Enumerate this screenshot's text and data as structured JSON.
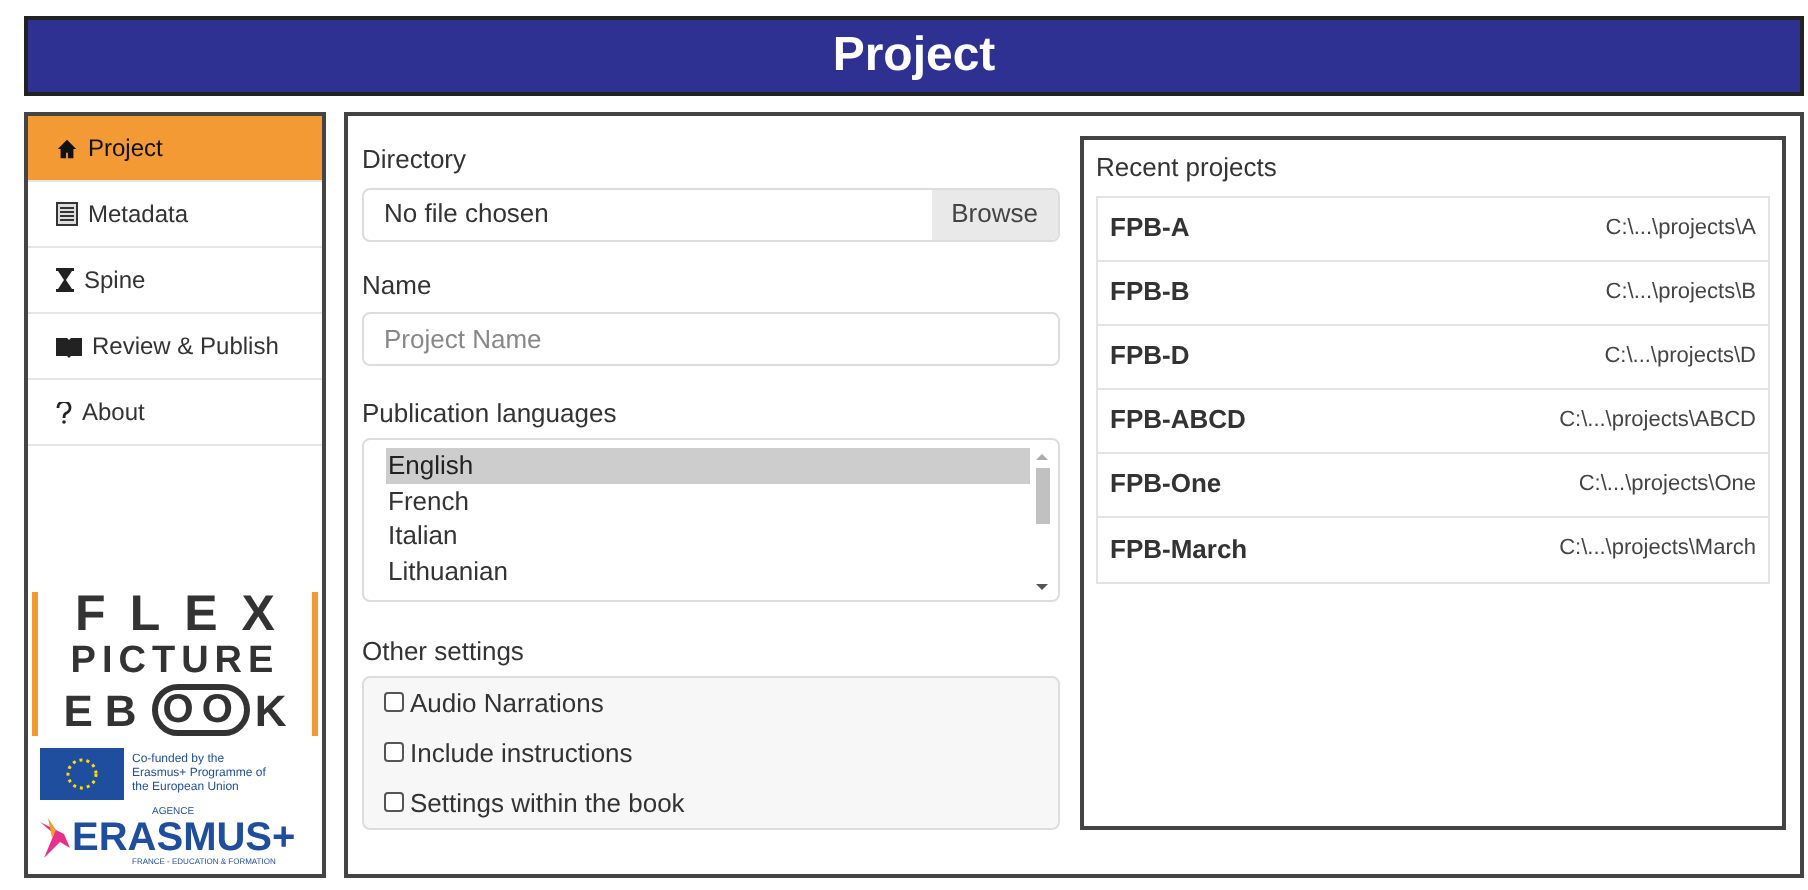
{
  "header": {
    "title": "Project"
  },
  "sidebar": {
    "items": [
      {
        "label": "Project",
        "selected": true
      },
      {
        "label": "Metadata",
        "selected": false
      },
      {
        "label": "Spine",
        "selected": false
      },
      {
        "label": "Review & Publish",
        "selected": false
      },
      {
        "label": "About",
        "selected": false
      }
    ],
    "logo": {
      "line_1": "FLEX",
      "line_2": "PICTURE",
      "line_3": [
        "EB",
        "OO",
        "K"
      ]
    },
    "eu_note": "Co-funded by the Erasmus+ Programme of the European Union",
    "agency": {
      "top": "AGENCE",
      "name": "ERASMUS+",
      "bottom": "FRANCE - EDUCATION & FORMATION"
    }
  },
  "form": {
    "directory": {
      "label": "Directory",
      "value": "No file chosen",
      "button": "Browse"
    },
    "name": {
      "label": "Name",
      "placeholder": "Project Name"
    },
    "languages": {
      "label": "Publication languages",
      "options": [
        {
          "label": "English",
          "selected": true
        },
        {
          "label": "French",
          "selected": false
        },
        {
          "label": "Italian",
          "selected": false
        },
        {
          "label": "Lithuanian",
          "selected": false
        }
      ]
    },
    "other_settings": {
      "label": "Other settings",
      "options": [
        {
          "label": "Audio Narrations",
          "checked": false
        },
        {
          "label": "Include instructions",
          "checked": false
        },
        {
          "label": "Settings within the book",
          "checked": false
        }
      ]
    }
  },
  "recent": {
    "title": "Recent projects",
    "projects": [
      {
        "name": "FPB-A",
        "path": "C:\\...\\projects\\A"
      },
      {
        "name": "FPB-B",
        "path": "C:\\...\\projects\\B"
      },
      {
        "name": "FPB-D",
        "path": "C:\\...\\projects\\D"
      },
      {
        "name": "FPB-ABCD",
        "path": "C:\\...\\projects\\ABCD"
      },
      {
        "name": "FPB-One",
        "path": "C:\\...\\projects\\One"
      },
      {
        "name": "FPB-March",
        "path": "C:\\...\\projects\\March"
      }
    ]
  }
}
